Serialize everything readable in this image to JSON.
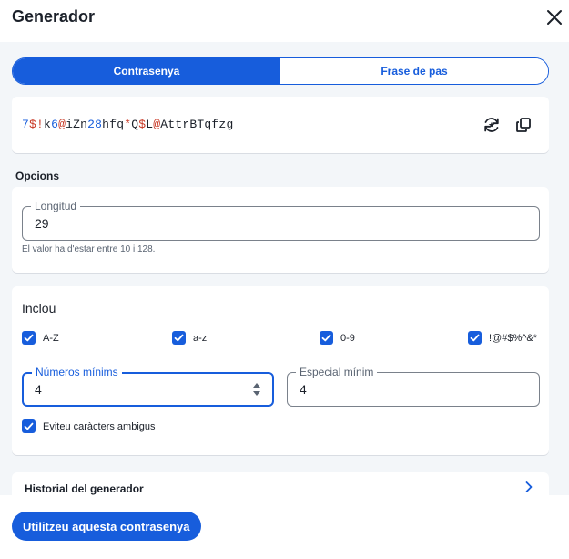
{
  "header": {
    "title": "Generador",
    "close_icon": "close-icon"
  },
  "type_toggle": {
    "options": [
      "Contrasenya",
      "Frase de pas"
    ],
    "selected": "Contrasenya"
  },
  "password": {
    "value": "7$!k6@iZn28hfq*Q$L@AttrBTqfzg",
    "regenerate_icon": "regenerate-icon",
    "copy_icon": "copy-icon"
  },
  "options": {
    "title": "Opcions",
    "length": {
      "label": "Longitud",
      "value": "29",
      "hint": "El valor ha d'estar entre 10 i 128."
    },
    "include": {
      "title": "Inclou",
      "checkboxes": [
        {
          "label": "A-Z",
          "checked": true
        },
        {
          "label": "a-z",
          "checked": true
        },
        {
          "label": "0-9",
          "checked": true
        },
        {
          "label": "!@#$%^&*",
          "checked": true
        }
      ],
      "min_numbers": {
        "label": "Números mínims",
        "value": "4"
      },
      "min_special": {
        "label": "Especial mínim",
        "value": "4"
      },
      "avoid_ambiguous": {
        "label": "Eviteu caràcters ambigus",
        "checked": true
      }
    }
  },
  "history": {
    "label": "Historial del generador",
    "chevron_icon": "chevron-right-icon"
  },
  "footer": {
    "use_button": "Utilitzeu aquesta contrasenya"
  },
  "colors": {
    "primary": "#175ddc",
    "background": "#f3f6f9",
    "special_char": "#c83522",
    "digit_char": "#175ddc"
  }
}
